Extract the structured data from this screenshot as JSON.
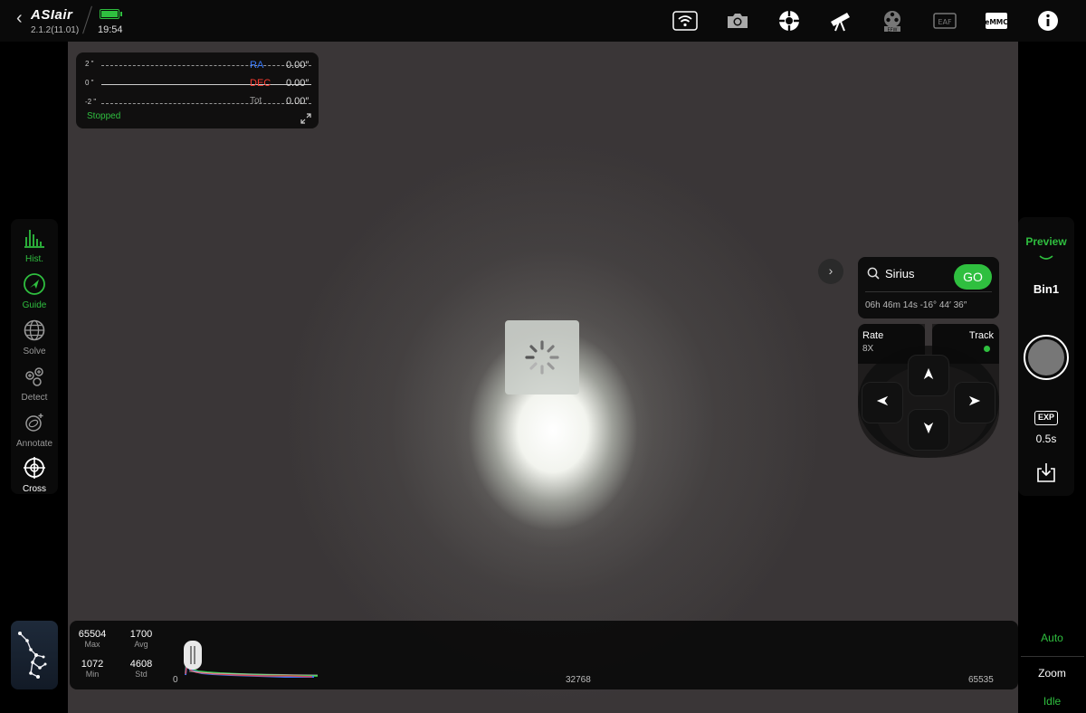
{
  "app": {
    "logo": "ASIair",
    "version": "2.1.2(11.01)",
    "clock": "19:54"
  },
  "topbar_icons": [
    "wifi-icon",
    "camera-icon",
    "guide-scope-icon",
    "telescope-icon",
    "filter-wheel-icon",
    "eaf-icon",
    "emmc-icon",
    "info-icon"
  ],
  "guide_graph": {
    "ticks": [
      "2 \"",
      "0 \"",
      "-2 \""
    ],
    "ra_label": "RA",
    "ra_value": "0.00″",
    "dec_label": "DEC",
    "dec_value": "0.00″",
    "tot_label": "Tot",
    "tot_value": "0.00″",
    "status": "Stopped",
    "colors": {
      "ra": "#3a7bff",
      "dec": "#ff3b30",
      "status": "#2fbf3f"
    }
  },
  "left_tools": [
    {
      "label": "Hist."
    },
    {
      "label": "Guide"
    },
    {
      "label": "Solve"
    },
    {
      "label": "Detect"
    },
    {
      "label": "Annotate"
    },
    {
      "label": "Cross"
    }
  ],
  "right_panel": {
    "preview_label": "Preview",
    "bin_label": "Bin1",
    "exp_icon": "EXP",
    "exp_value": "0.5s"
  },
  "goto": {
    "target": "Sirius",
    "go_label": "GO",
    "coords": "06h 46m 14s  -16° 44′ 36″"
  },
  "mount": {
    "rate_label": "Rate",
    "rate_value": "8X",
    "track_label": "Track"
  },
  "histogram": {
    "max_value": "65504",
    "max_label": "Max",
    "avg_value": "1700",
    "avg_label": "Avg",
    "min_value": "1072",
    "min_label": "Min",
    "std_value": "4608",
    "std_label": "Std",
    "axis": [
      "0",
      "32768",
      "65535"
    ]
  },
  "bottom_right": {
    "auto_label": "Auto",
    "zoom_label": "Zoom",
    "idle_label": "Idle"
  },
  "accent_color": "#2fbf3f"
}
